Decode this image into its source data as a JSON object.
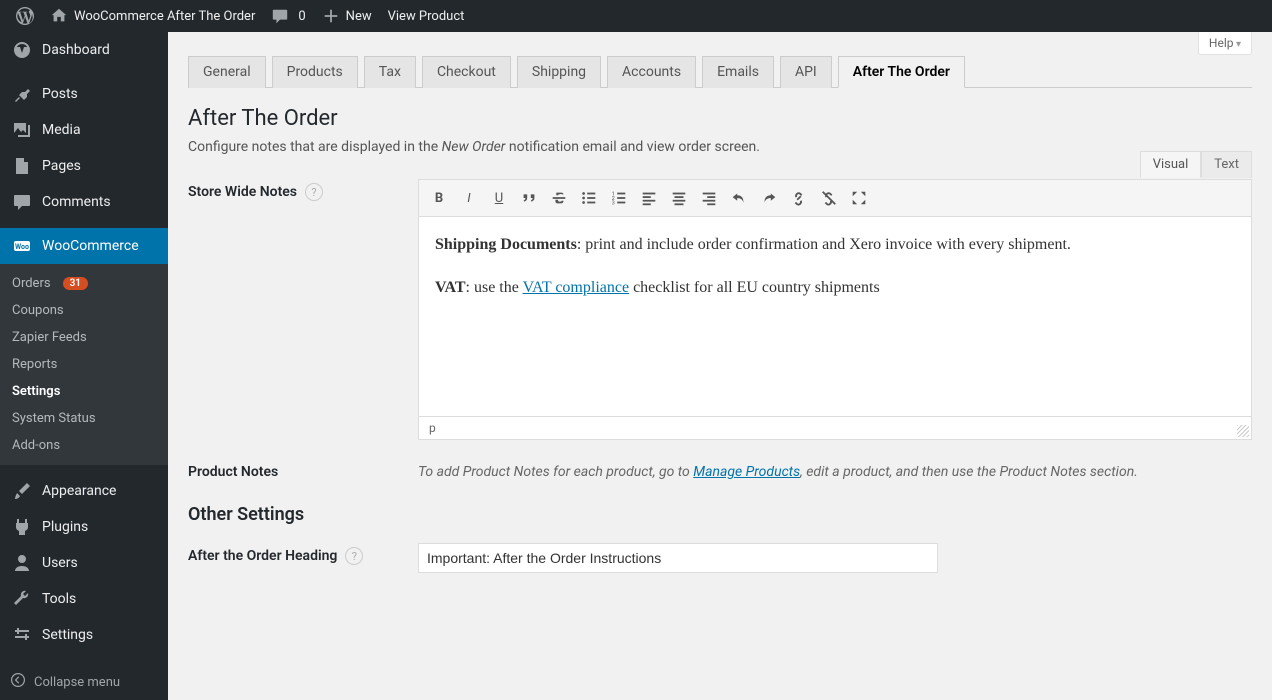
{
  "adminbar": {
    "site_title": "WooCommerce After The Order",
    "comments_count": "0",
    "new_label": "New",
    "view_product": "View Product"
  },
  "sidebar": {
    "items": [
      {
        "label": "Dashboard"
      },
      {
        "label": "Posts"
      },
      {
        "label": "Media"
      },
      {
        "label": "Pages"
      },
      {
        "label": "Comments"
      },
      {
        "label": "WooCommerce"
      },
      {
        "label": "Appearance"
      },
      {
        "label": "Plugins"
      },
      {
        "label": "Users"
      },
      {
        "label": "Tools"
      },
      {
        "label": "Settings"
      }
    ],
    "wc_submenu": [
      {
        "label": "Orders",
        "badge": "31"
      },
      {
        "label": "Coupons"
      },
      {
        "label": "Zapier Feeds"
      },
      {
        "label": "Reports"
      },
      {
        "label": "Settings"
      },
      {
        "label": "System Status"
      },
      {
        "label": "Add-ons"
      }
    ],
    "collapse": "Collapse menu"
  },
  "help_tab": "Help",
  "tabs": [
    "General",
    "Products",
    "Tax",
    "Checkout",
    "Shipping",
    "Accounts",
    "Emails",
    "API",
    "After The Order"
  ],
  "active_tab_index": 8,
  "page_title": "After The Order",
  "subtitle_pre": "Configure notes that are displayed in the ",
  "subtitle_em": "New Order",
  "subtitle_post": " notification email and view order screen.",
  "labels": {
    "store_notes": "Store Wide Notes",
    "product_notes": "Product Notes",
    "other_settings": "Other Settings",
    "after_order_heading": "After the Order Heading"
  },
  "editor": {
    "visual": "Visual",
    "text": "Text",
    "content": {
      "line1_bold": "Shipping Documents",
      "line1_rest": ": print and include order confirmation and Xero invoice with every shipment.",
      "line2_bold": "VAT",
      "line2_pre": ": use the ",
      "line2_link": "VAT compliance",
      "line2_post": " checklist for all EU country shipments"
    },
    "status_path": "p"
  },
  "product_notes_text": {
    "pre": "To add Product Notes for each product, go to ",
    "link": "Manage Products",
    "post": ", edit a product, and then use the Product Notes section."
  },
  "after_order_heading_value": "Important: After the Order Instructions"
}
